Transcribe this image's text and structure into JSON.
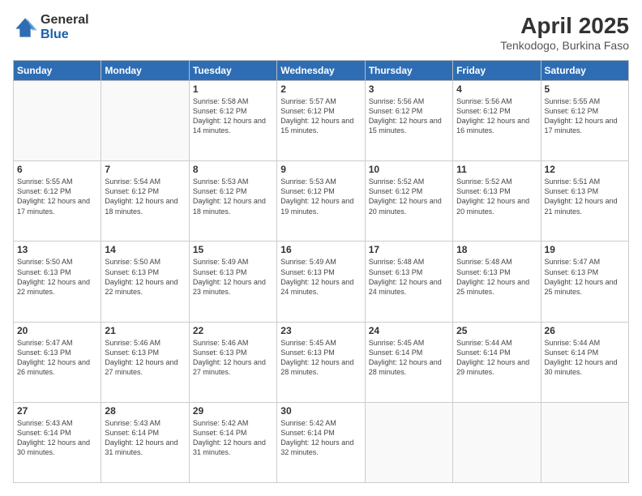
{
  "logo": {
    "general": "General",
    "blue": "Blue"
  },
  "title": "April 2025",
  "subtitle": "Tenkodogo, Burkina Faso",
  "headers": [
    "Sunday",
    "Monday",
    "Tuesday",
    "Wednesday",
    "Thursday",
    "Friday",
    "Saturday"
  ],
  "weeks": [
    [
      {
        "day": "",
        "info": ""
      },
      {
        "day": "",
        "info": ""
      },
      {
        "day": "1",
        "info": "Sunrise: 5:58 AM\nSunset: 6:12 PM\nDaylight: 12 hours and 14 minutes."
      },
      {
        "day": "2",
        "info": "Sunrise: 5:57 AM\nSunset: 6:12 PM\nDaylight: 12 hours and 15 minutes."
      },
      {
        "day": "3",
        "info": "Sunrise: 5:56 AM\nSunset: 6:12 PM\nDaylight: 12 hours and 15 minutes."
      },
      {
        "day": "4",
        "info": "Sunrise: 5:56 AM\nSunset: 6:12 PM\nDaylight: 12 hours and 16 minutes."
      },
      {
        "day": "5",
        "info": "Sunrise: 5:55 AM\nSunset: 6:12 PM\nDaylight: 12 hours and 17 minutes."
      }
    ],
    [
      {
        "day": "6",
        "info": "Sunrise: 5:55 AM\nSunset: 6:12 PM\nDaylight: 12 hours and 17 minutes."
      },
      {
        "day": "7",
        "info": "Sunrise: 5:54 AM\nSunset: 6:12 PM\nDaylight: 12 hours and 18 minutes."
      },
      {
        "day": "8",
        "info": "Sunrise: 5:53 AM\nSunset: 6:12 PM\nDaylight: 12 hours and 18 minutes."
      },
      {
        "day": "9",
        "info": "Sunrise: 5:53 AM\nSunset: 6:12 PM\nDaylight: 12 hours and 19 minutes."
      },
      {
        "day": "10",
        "info": "Sunrise: 5:52 AM\nSunset: 6:12 PM\nDaylight: 12 hours and 20 minutes."
      },
      {
        "day": "11",
        "info": "Sunrise: 5:52 AM\nSunset: 6:13 PM\nDaylight: 12 hours and 20 minutes."
      },
      {
        "day": "12",
        "info": "Sunrise: 5:51 AM\nSunset: 6:13 PM\nDaylight: 12 hours and 21 minutes."
      }
    ],
    [
      {
        "day": "13",
        "info": "Sunrise: 5:50 AM\nSunset: 6:13 PM\nDaylight: 12 hours and 22 minutes."
      },
      {
        "day": "14",
        "info": "Sunrise: 5:50 AM\nSunset: 6:13 PM\nDaylight: 12 hours and 22 minutes."
      },
      {
        "day": "15",
        "info": "Sunrise: 5:49 AM\nSunset: 6:13 PM\nDaylight: 12 hours and 23 minutes."
      },
      {
        "day": "16",
        "info": "Sunrise: 5:49 AM\nSunset: 6:13 PM\nDaylight: 12 hours and 24 minutes."
      },
      {
        "day": "17",
        "info": "Sunrise: 5:48 AM\nSunset: 6:13 PM\nDaylight: 12 hours and 24 minutes."
      },
      {
        "day": "18",
        "info": "Sunrise: 5:48 AM\nSunset: 6:13 PM\nDaylight: 12 hours and 25 minutes."
      },
      {
        "day": "19",
        "info": "Sunrise: 5:47 AM\nSunset: 6:13 PM\nDaylight: 12 hours and 25 minutes."
      }
    ],
    [
      {
        "day": "20",
        "info": "Sunrise: 5:47 AM\nSunset: 6:13 PM\nDaylight: 12 hours and 26 minutes."
      },
      {
        "day": "21",
        "info": "Sunrise: 5:46 AM\nSunset: 6:13 PM\nDaylight: 12 hours and 27 minutes."
      },
      {
        "day": "22",
        "info": "Sunrise: 5:46 AM\nSunset: 6:13 PM\nDaylight: 12 hours and 27 minutes."
      },
      {
        "day": "23",
        "info": "Sunrise: 5:45 AM\nSunset: 6:13 PM\nDaylight: 12 hours and 28 minutes."
      },
      {
        "day": "24",
        "info": "Sunrise: 5:45 AM\nSunset: 6:14 PM\nDaylight: 12 hours and 28 minutes."
      },
      {
        "day": "25",
        "info": "Sunrise: 5:44 AM\nSunset: 6:14 PM\nDaylight: 12 hours and 29 minutes."
      },
      {
        "day": "26",
        "info": "Sunrise: 5:44 AM\nSunset: 6:14 PM\nDaylight: 12 hours and 30 minutes."
      }
    ],
    [
      {
        "day": "27",
        "info": "Sunrise: 5:43 AM\nSunset: 6:14 PM\nDaylight: 12 hours and 30 minutes."
      },
      {
        "day": "28",
        "info": "Sunrise: 5:43 AM\nSunset: 6:14 PM\nDaylight: 12 hours and 31 minutes."
      },
      {
        "day": "29",
        "info": "Sunrise: 5:42 AM\nSunset: 6:14 PM\nDaylight: 12 hours and 31 minutes."
      },
      {
        "day": "30",
        "info": "Sunrise: 5:42 AM\nSunset: 6:14 PM\nDaylight: 12 hours and 32 minutes."
      },
      {
        "day": "",
        "info": ""
      },
      {
        "day": "",
        "info": ""
      },
      {
        "day": "",
        "info": ""
      }
    ]
  ]
}
